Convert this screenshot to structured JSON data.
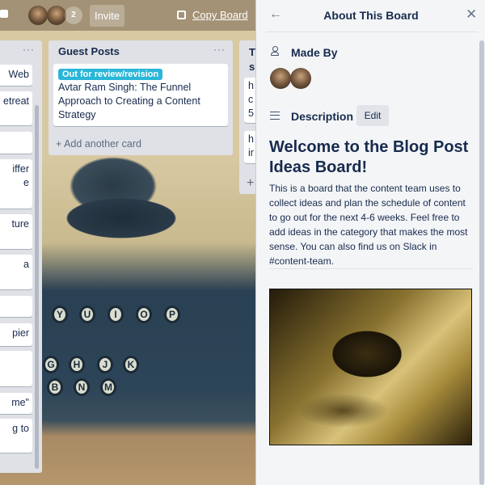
{
  "topbar": {
    "member_count": "2",
    "invite_label": "Invite",
    "copy_board_label": "Copy Board"
  },
  "lists": {
    "left_partial": {
      "cards": [
        "Web",
        "etreat",
        "",
        "iffer\ne",
        "",
        "ture",
        "a",
        "",
        "pier",
        "",
        "me\"",
        "g to"
      ]
    },
    "guest_posts": {
      "title": "Guest Posts",
      "card": {
        "label": "Out for review/revision",
        "label_color": "#29b6d8",
        "title": "Avtar Ram Singh: The Funnel Approach to Creating a Content Strategy"
      },
      "add_card": "+ Add another card"
    },
    "right_partial": {
      "title": "T\ns",
      "cards": [
        "h\nc\n5",
        "h\nir"
      ],
      "add": "+"
    }
  },
  "panel": {
    "title": "About This Board",
    "made_by": "Made By",
    "description_heading": "Description",
    "edit_label": "Edit",
    "heading": "Welcome to the Blog Post Ideas Board!",
    "body": "This is a board that the content team uses to collect ideas and plan the schedule of content to go out for the next 4-6 weeks. Feel free to add ideas in the category that makes the most sense. You can also find us on Slack in #content-team."
  },
  "keys": [
    "Y",
    "U",
    "I",
    "O",
    "P",
    "G",
    "H",
    "J",
    "K",
    "B",
    "N",
    "M"
  ]
}
